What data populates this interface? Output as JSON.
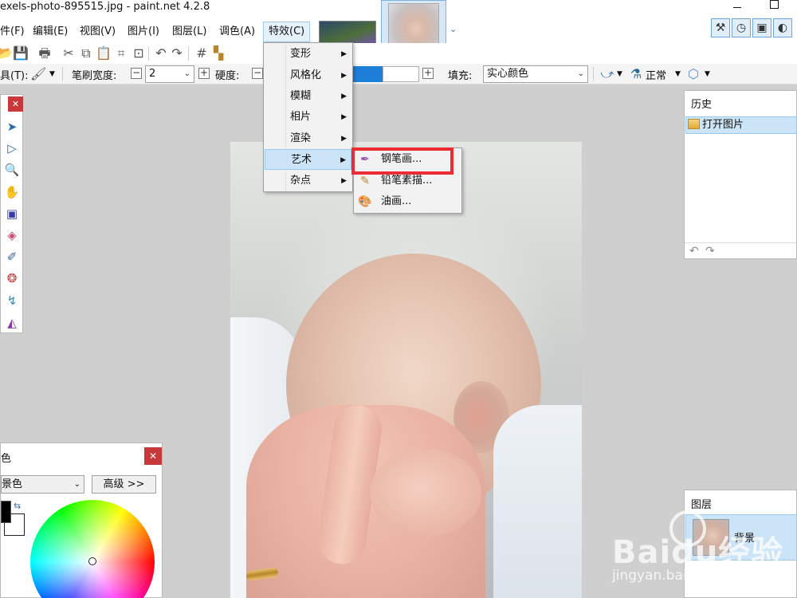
{
  "window": {
    "title": "exels-photo-895515.jpg - paint.net 4.2.8"
  },
  "menubar": {
    "items": [
      "件(F)",
      "编辑(E)",
      "视图(V)",
      "图片(I)",
      "图层(L)",
      "调色(A)",
      "特效(C)"
    ]
  },
  "toolbar_options": {
    "tool_label": "具(T):",
    "brush_width_label": "笔刷宽度:",
    "brush_width_value": "2",
    "hardness_label": "硬度:",
    "fill_label": "填充:",
    "fill_value": "实心颜色",
    "blend_value": "正常"
  },
  "effects_menu": {
    "items": [
      {
        "label": "变形",
        "has_submenu": true
      },
      {
        "label": "风格化",
        "has_submenu": true
      },
      {
        "label": "模糊",
        "has_submenu": true
      },
      {
        "label": "相片",
        "has_submenu": true
      },
      {
        "label": "渲染",
        "has_submenu": true
      },
      {
        "label": "艺术",
        "has_submenu": true,
        "highlighted": true
      },
      {
        "label": "杂点",
        "has_submenu": true
      }
    ]
  },
  "art_submenu": {
    "items": [
      {
        "label": "钢笔画...",
        "icon": "ink-pen-icon"
      },
      {
        "label": "铅笔素描...",
        "icon": "pencil-sketch-icon"
      },
      {
        "label": "油画...",
        "icon": "palette-icon"
      }
    ]
  },
  "history_panel": {
    "title": "历史",
    "items": [
      "打开图片"
    ]
  },
  "layers_panel": {
    "title": "图层",
    "layer_name": "背景"
  },
  "colors_panel": {
    "title": "色",
    "mode": "景色",
    "advanced_label": "高级 >>"
  },
  "watermark": {
    "logo": "Baidu经验",
    "url": "jingyan.baidu.com"
  },
  "colors": {
    "accent": "#cce4f7",
    "highlight_box": "#ee2a32",
    "close_button": "#c8383a"
  }
}
